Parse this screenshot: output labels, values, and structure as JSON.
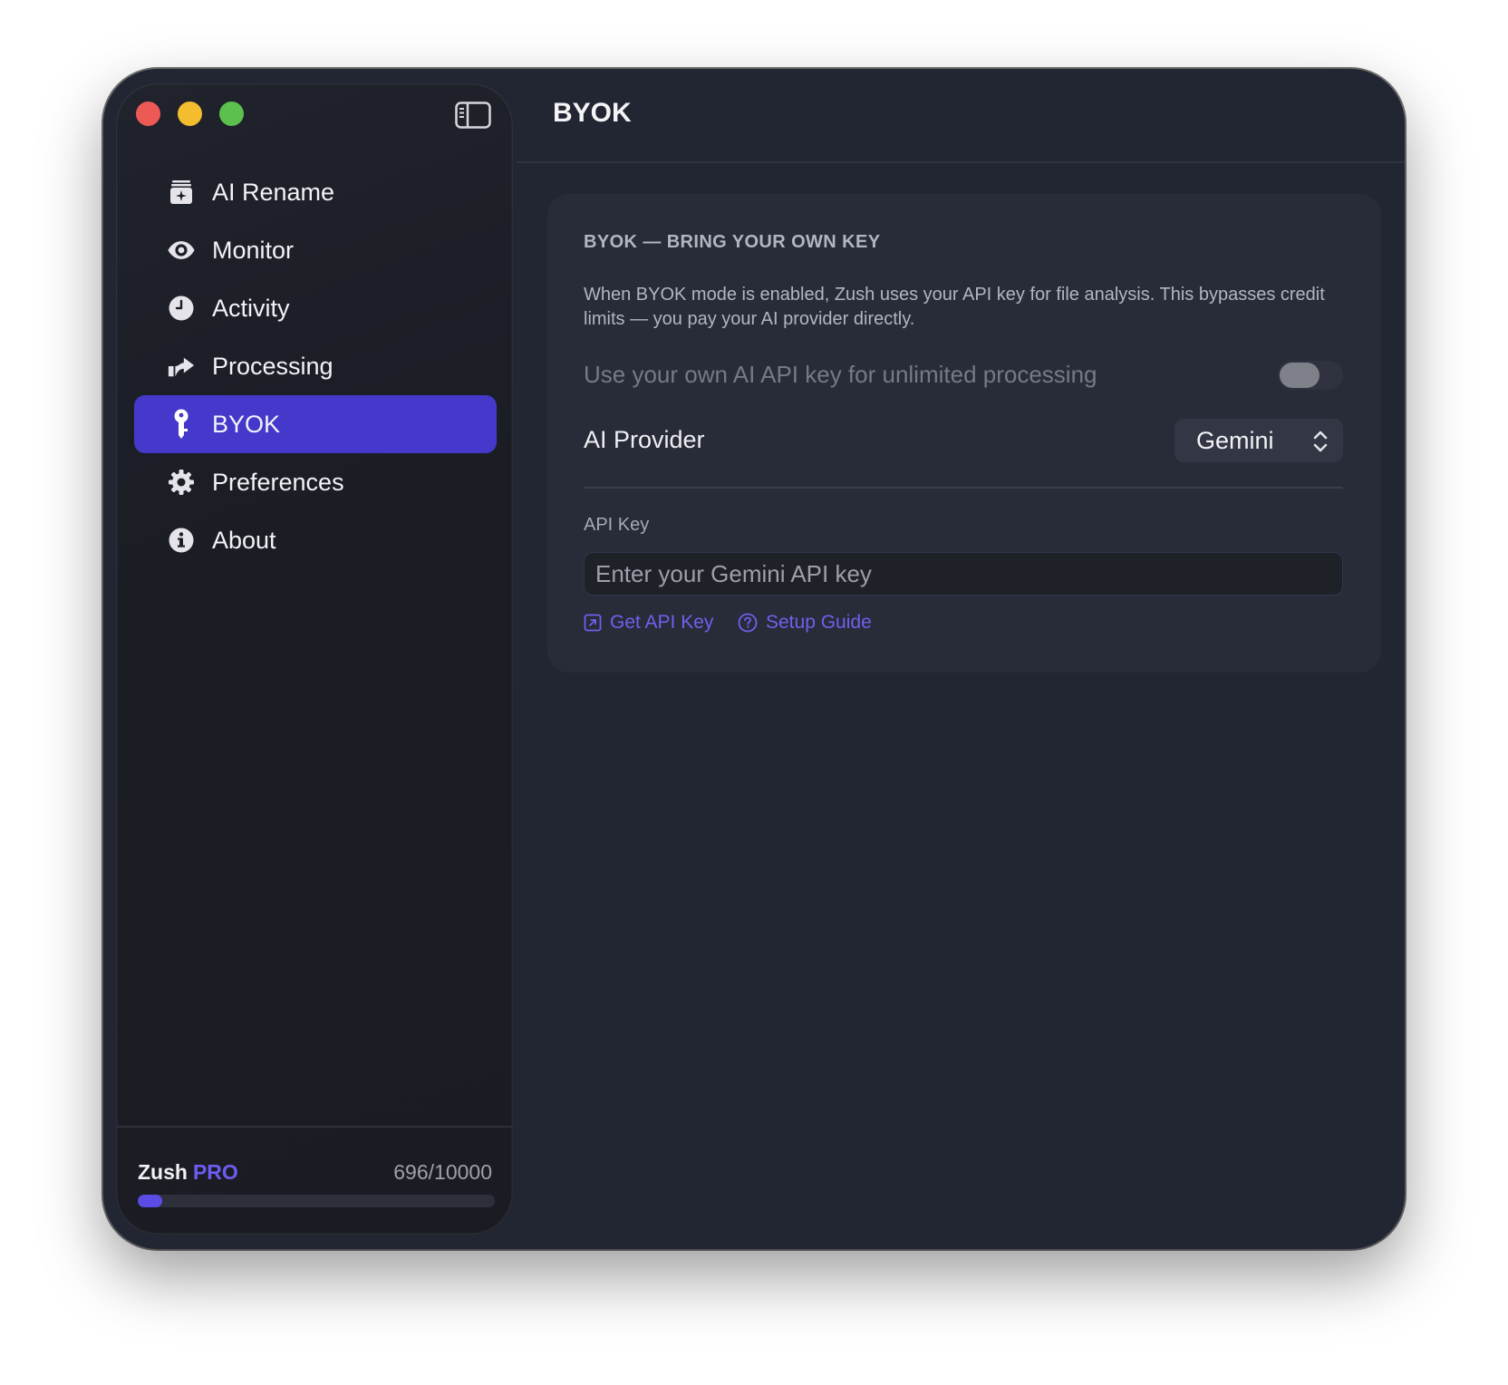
{
  "sidebar": {
    "items": [
      {
        "label": "AI Rename",
        "icon": "sparkle-tray-icon",
        "active": false
      },
      {
        "label": "Monitor",
        "icon": "eye-icon",
        "active": false
      },
      {
        "label": "Activity",
        "icon": "clock-icon",
        "active": false
      },
      {
        "label": "Processing",
        "icon": "share-arrow-icon",
        "active": false
      },
      {
        "label": "BYOK",
        "icon": "key-icon",
        "active": true
      },
      {
        "label": "Preferences",
        "icon": "gear-icon",
        "active": false
      },
      {
        "label": "About",
        "icon": "info-icon",
        "active": false
      }
    ],
    "plan": {
      "app": "Zush",
      "tier": "PRO"
    },
    "usage": {
      "text": "696/10000",
      "used": 696,
      "limit": 10000
    }
  },
  "main": {
    "title": "BYOK",
    "card": {
      "heading": "BYOK — BRING YOUR OWN KEY",
      "description": "When BYOK mode is enabled, Zush uses your API key for file analysis. This bypasses credit limits — you pay your AI provider directly.",
      "toggle_label": "Use your own AI API key for unlimited processing",
      "toggle_on": false,
      "provider_label": "AI Provider",
      "provider_value": "Gemini",
      "api_key_label": "API Key",
      "api_key_value": "",
      "api_key_placeholder": "Enter your Gemini API key",
      "links": {
        "get_key": "Get API Key",
        "setup_guide": "Setup Guide"
      }
    }
  },
  "colors": {
    "accent": "#4539cc",
    "link": "#6f60ee",
    "window_bg": "#222532",
    "sidebar_bg": "#1b1d25",
    "card_bg": "#282b38"
  }
}
